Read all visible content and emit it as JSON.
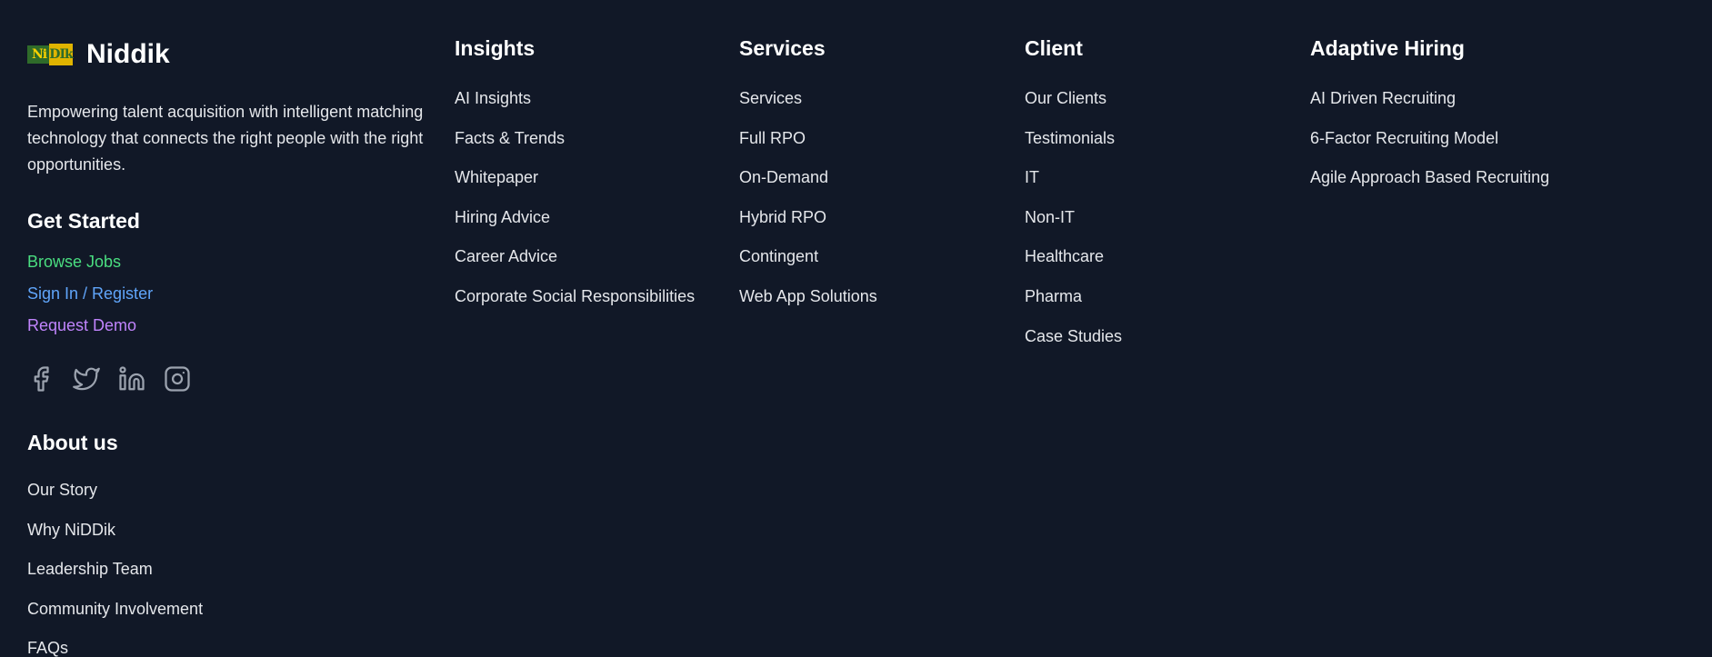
{
  "brand": {
    "logo_part1": "Ni",
    "logo_part2": "DIk",
    "name": "Niddik",
    "tagline": "Empowering talent acquisition with intelligent matching technology that connects the right people with the right opportunities."
  },
  "get_started": {
    "heading": "Get Started",
    "links": [
      {
        "label": "Browse Jobs",
        "color": "#4ade80"
      },
      {
        "label": "Sign In / Register",
        "color": "#60a5fa"
      },
      {
        "label": "Request Demo",
        "color": "#c084fc"
      }
    ]
  },
  "social": [
    {
      "icon": "facebook-icon"
    },
    {
      "icon": "twitter-icon"
    },
    {
      "icon": "linkedin-icon"
    },
    {
      "icon": "instagram-icon"
    }
  ],
  "about": {
    "heading": "About us",
    "links": [
      "Our Story",
      "Why NiDDik",
      "Leadership Team",
      "Community Involvement",
      "FAQs"
    ]
  },
  "insights": {
    "heading": "Insights",
    "links": [
      "AI Insights",
      "Facts & Trends",
      "Whitepaper",
      "Hiring Advice",
      "Career Advice",
      "Corporate Social Responsibilities"
    ]
  },
  "services": {
    "heading": "Services",
    "links": [
      "Services",
      "Full RPO",
      "On-Demand",
      "Hybrid RPO",
      "Contingent",
      "Web App Solutions"
    ]
  },
  "client": {
    "heading": "Client",
    "links": [
      "Our Clients",
      "Testimonials",
      "IT",
      "Non-IT",
      "Healthcare",
      "Pharma",
      "Case Studies"
    ]
  },
  "adaptive_hiring": {
    "heading": "Adaptive Hiring",
    "links": [
      "AI Driven Recruiting",
      "6-Factor Recruiting Model",
      "Agile Approach Based Recruiting"
    ]
  },
  "colors": {
    "background": "#111827",
    "heading": "#ffffff",
    "link": "#e5e7eb",
    "icon": "#9ca3af"
  }
}
